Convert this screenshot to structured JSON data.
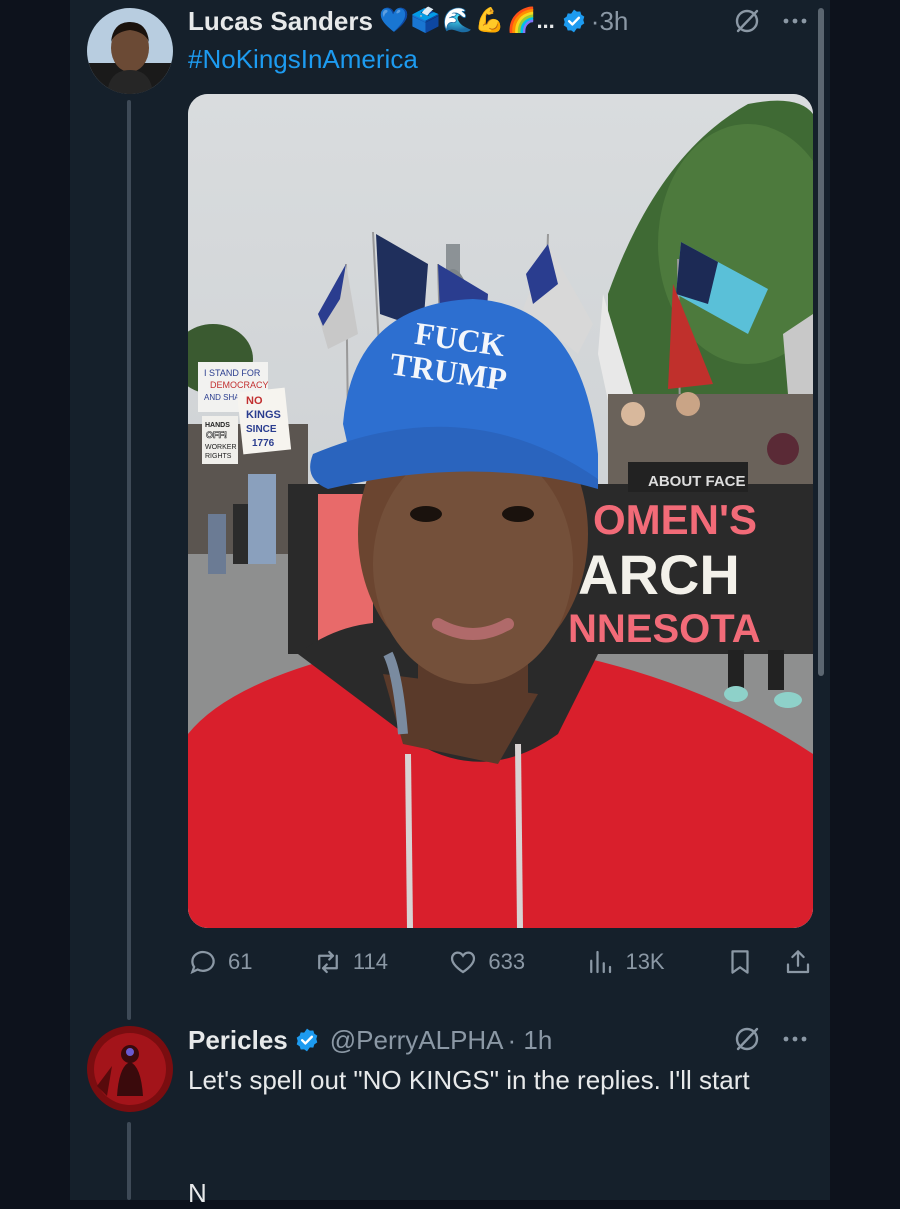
{
  "tweet": {
    "author_name": "Lucas Sanders",
    "badge_emojis": [
      "💙",
      "🗳️",
      "🌊",
      "💪",
      "🌈"
    ],
    "name_ellipsis": "...",
    "time": "·3h",
    "text": "#NoKingsInAmerica",
    "image_sign_text": {
      "cap": [
        "FUCK",
        "TRUMP"
      ],
      "banner": [
        "OMEN'S",
        "ARCH",
        "NNESOTA"
      ],
      "banner_top": "ABOUT FACE",
      "sign_left": [
        "I STAND FOR",
        "DEMOCRACY",
        "AND SHALL FOR"
      ],
      "sign_kings": [
        "NO",
        "KINGS",
        "SINCE",
        "1776"
      ],
      "sign_hands": [
        "HANDS",
        "OFF!",
        "WORKER",
        "RIGHTS"
      ]
    },
    "stats": {
      "replies": "61",
      "reposts": "114",
      "likes": "633",
      "views": "13K"
    },
    "icons": {
      "verified": "verified-badge-icon",
      "muted": "muted-icon",
      "more": "more-options-icon",
      "reply": "reply-icon",
      "repost": "repost-icon",
      "like": "heart-icon",
      "views": "views-chart-icon",
      "bookmark": "bookmark-icon",
      "share": "share-icon"
    }
  },
  "reply": {
    "author_name": "Pericles",
    "handle": "@PerryALPHA",
    "time": "· 1h",
    "text": "Let's spell out \"NO KINGS\" in the replies. I'll start",
    "letter": "N"
  },
  "colors": {
    "background": "#15202b",
    "outer": "#0d121c",
    "accent": "#1d9bf0",
    "muted_text": "#8b98a5",
    "thread_line": "#3e4a57"
  }
}
